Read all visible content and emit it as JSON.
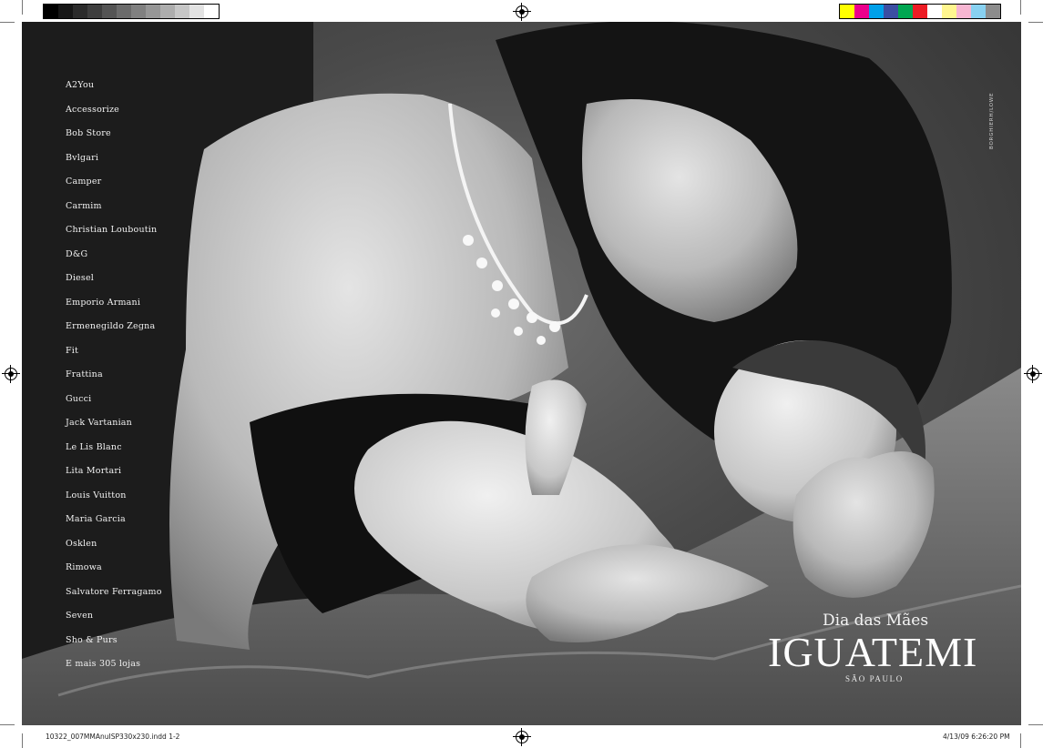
{
  "print_marks": {
    "gray_swatches": [
      "#000000",
      "#161616",
      "#2b2b2b",
      "#3e3e3e",
      "#545454",
      "#6b6b6b",
      "#808080",
      "#969696",
      "#adadad",
      "#c6c6c6",
      "#e3e3e3",
      "#ffffff"
    ],
    "color_swatches": [
      "#ffff00",
      "#ec008c",
      "#00a0e9",
      "#3b4ea2",
      "#00a651",
      "#ed1c24",
      "#ffffff",
      "#fff68f",
      "#f7b6d2",
      "#88d1f1",
      "#8c8c8c"
    ],
    "slug_text": "10322_007MMAnuISP330x230.indd   1-2",
    "timestamp_text": "4/13/09   6:26:20 PM"
  },
  "ad": {
    "stores": [
      "A2You",
      "Accessorize",
      "Bob Store",
      "Bvlgari",
      "Camper",
      "Carmim",
      "Christian Louboutin",
      "D&G",
      "Diesel",
      "Emporio Armani",
      "Ermenegildo Zegna",
      "Fit",
      "Frattina",
      "Gucci",
      "Jack Vartanian",
      "Le Lis Blanc",
      "Lita Mortari",
      "Louis Vuitton",
      "Maria Garcia",
      "Osklen",
      "Rimowa",
      "Salvatore Ferragamo",
      "Seven",
      "Sho & Purs",
      "E mais 305 lojas"
    ],
    "agency_credit": "BORGHIERH/LOWE",
    "tagline": "Dia das Mães",
    "logo_text": "IGUATEMI",
    "city": "SÃO PAULO"
  }
}
